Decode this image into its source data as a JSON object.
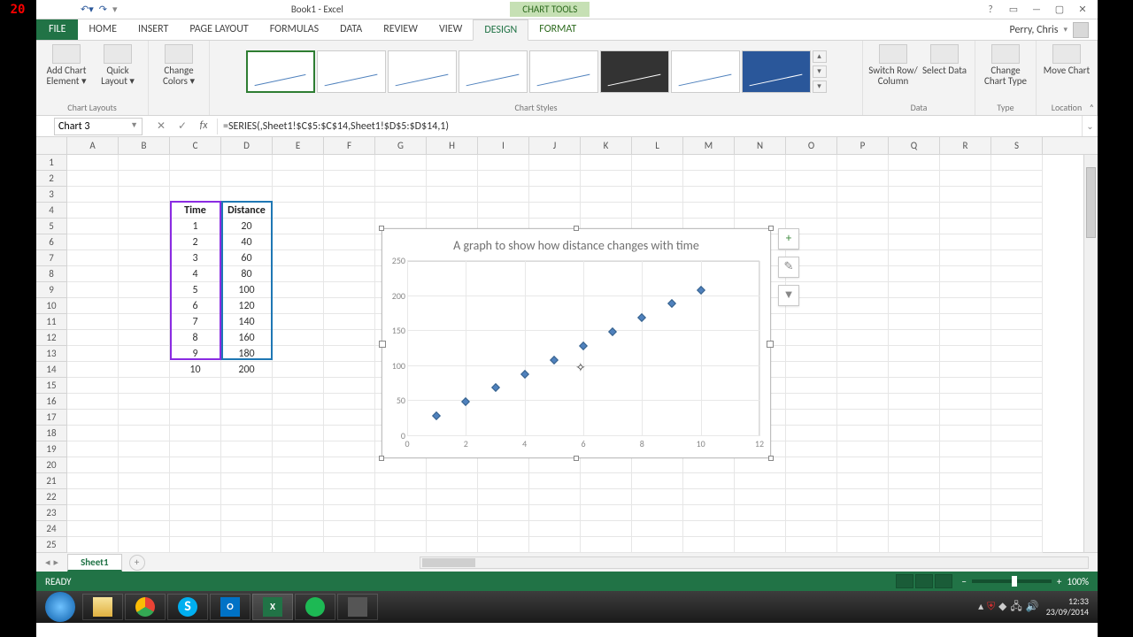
{
  "rec_badge": "20",
  "titlebar": {
    "doc": "Book1 - Excel",
    "charttools": "CHART TOOLS"
  },
  "win_user": "Perry, Chris",
  "tabs": {
    "file": "FILE",
    "items": [
      "HOME",
      "INSERT",
      "PAGE LAYOUT",
      "FORMULAS",
      "DATA",
      "REVIEW",
      "VIEW"
    ],
    "ctx": [
      "DESIGN",
      "FORMAT"
    ],
    "active": "DESIGN"
  },
  "ribbon": {
    "add_element": "Add Chart Element ▾",
    "quick_layout": "Quick Layout ▾",
    "change_colors": "Change Colors ▾",
    "group_layouts": "Chart Layouts",
    "group_styles": "Chart Styles",
    "switch": "Switch Row/ Column",
    "select_data": "Select Data",
    "group_data": "Data",
    "change_type": "Change Chart Type",
    "group_type": "Type",
    "move_chart": "Move Chart",
    "group_loc": "Location"
  },
  "namebox": "Chart 3",
  "formula": "=SERIES(,Sheet1!$C$5:$C$14,Sheet1!$D$5:$D$14,1)",
  "columns": [
    "A",
    "B",
    "C",
    "D",
    "E",
    "F",
    "G",
    "H",
    "I",
    "J",
    "K",
    "L",
    "M",
    "N",
    "O",
    "P",
    "Q",
    "R",
    "S"
  ],
  "row_count": 25,
  "table": {
    "headers": {
      "c": "Time",
      "d": "Distance"
    },
    "rows": [
      {
        "c": "1",
        "d": "20"
      },
      {
        "c": "2",
        "d": "40"
      },
      {
        "c": "3",
        "d": "60"
      },
      {
        "c": "4",
        "d": "80"
      },
      {
        "c": "5",
        "d": "100"
      },
      {
        "c": "6",
        "d": "120"
      },
      {
        "c": "7",
        "d": "140"
      },
      {
        "c": "8",
        "d": "160"
      },
      {
        "c": "9",
        "d": "180"
      },
      {
        "c": "10",
        "d": "200"
      }
    ]
  },
  "chart": {
    "title": "A graph to show how distance changes with time",
    "yticks": [
      0,
      50,
      100,
      150,
      200,
      250
    ],
    "xticks": [
      0,
      2,
      4,
      6,
      8,
      10,
      12
    ]
  },
  "chart_data": {
    "type": "scatter",
    "title": "A graph to show how distance changes with time",
    "xlabel": "",
    "ylabel": "",
    "xlim": [
      0,
      12
    ],
    "ylim": [
      0,
      250
    ],
    "x": [
      1,
      2,
      3,
      4,
      5,
      6,
      7,
      8,
      9,
      10
    ],
    "y": [
      20,
      40,
      60,
      80,
      100,
      120,
      140,
      160,
      180,
      200
    ]
  },
  "sheet": {
    "name": "Sheet1"
  },
  "status": {
    "ready": "READY",
    "zoom": "100%"
  },
  "tray": {
    "time": "12:33",
    "date": "23/09/2014"
  }
}
